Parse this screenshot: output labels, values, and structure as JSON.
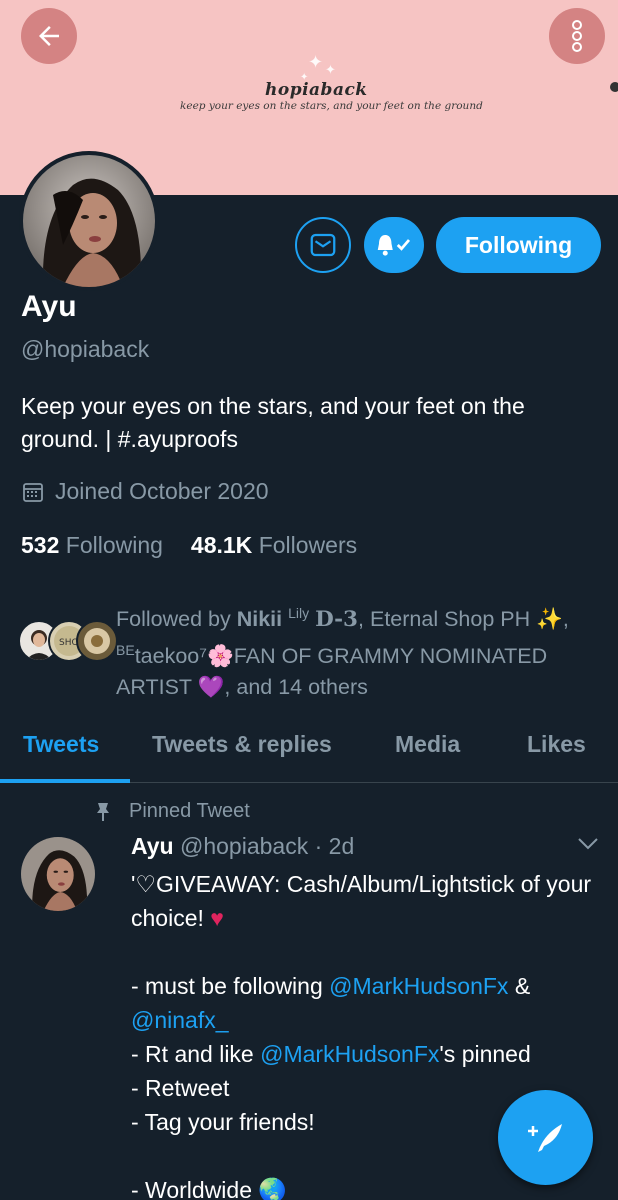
{
  "banner": {
    "title": "hopiaback",
    "tagline": "keep your eyes on the stars, and your feet on the ground"
  },
  "colors": {
    "accent": "#1da1f2",
    "background": "#15202b",
    "banner": "#f6c4c3",
    "muted": "#8899a6"
  },
  "icons": {
    "back": "arrow-left-icon",
    "more": "more-vertical-icon",
    "mail": "envelope-icon",
    "bell": "bell-check-icon",
    "calendar": "calendar-icon",
    "pin": "pin-icon",
    "chevron": "chevron-down-icon",
    "compose": "compose-tweet-icon"
  },
  "profile": {
    "name": "Ayu",
    "handle": "@hopiaback",
    "follow_label": "Following",
    "bio": "Keep your eyes on the stars, and your feet on the ground. | #.ayuproofs",
    "joined": "Joined October 2020",
    "following_count": "532",
    "following_label": "Following",
    "followers_count": "48.1K",
    "followers_label": "Followers"
  },
  "followed_by": {
    "prefix": "Followed by ",
    "name1": "Nikii",
    "name1_super": "Lily",
    "name1_suffix": "D-3",
    "mid": ", Eternal Shop PH ✨,",
    "name3_super": "BE",
    "name3": "taekoo⁷🌸FAN OF GRAMMY NOMINATED ARTIST 💜",
    "tail": ", and 14 others"
  },
  "tabs": [
    {
      "label": "Tweets"
    },
    {
      "label": "Tweets & replies"
    },
    {
      "label": "Media"
    },
    {
      "label": "Likes"
    }
  ],
  "tweet": {
    "pinned_label": "Pinned Tweet",
    "author": "Ayu",
    "handle": "@hopiaback",
    "time": "· 2d",
    "line1": "'♡GIVEAWAY: Cash/Album/Lightstick of your choice! ",
    "heart": "♥",
    "line2_pre": "- must be following ",
    "mention1": "@MarkHudsonFx",
    "line2_mid": " &",
    "mention2": "@ninafx_",
    "line3_pre": "- Rt and like ",
    "mention3": "@MarkHudsonFx",
    "line3_post": "'s pinned",
    "line4": "- Retweet",
    "line5": "- Tag your friends!",
    "line6": "- Worldwide 🌏"
  }
}
